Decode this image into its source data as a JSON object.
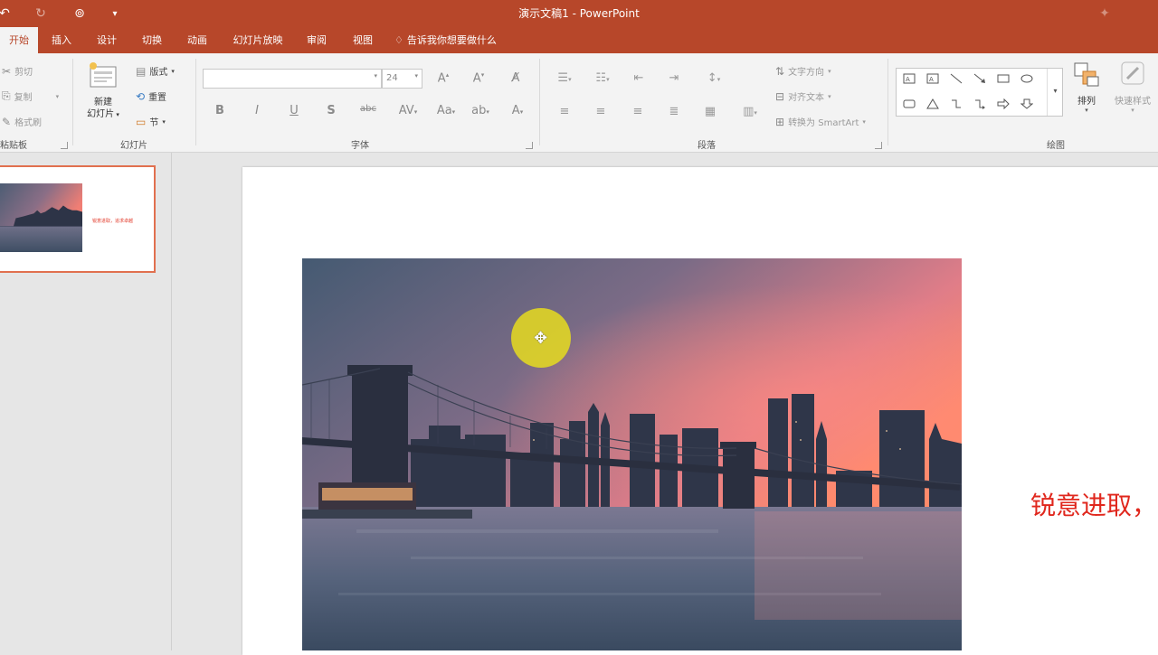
{
  "window": {
    "title": "演示文稿1  -  PowerPoint"
  },
  "qat": {
    "undo_icon": "undo-icon",
    "redo_icon": "redo-icon",
    "present_icon": "start-from-beginning-icon",
    "customize_icon": "customize-qat-icon"
  },
  "tabs": [
    {
      "label": "开始",
      "active": true
    },
    {
      "label": "插入"
    },
    {
      "label": "设计"
    },
    {
      "label": "切换"
    },
    {
      "label": "动画"
    },
    {
      "label": "幻灯片放映"
    },
    {
      "label": "审阅"
    },
    {
      "label": "视图"
    }
  ],
  "tell_me": {
    "text": "告诉我你想要做什么"
  },
  "clipboard": {
    "cut": "剪切",
    "copy": "复制",
    "format_painter": "格式刷",
    "group_label": "粘贴板"
  },
  "slides_group": {
    "new_slide_line1": "新建",
    "new_slide_line2": "幻灯片",
    "layout": "版式",
    "reset": "重置",
    "section": "节",
    "group_label": "幻灯片"
  },
  "font_group": {
    "font_name": "",
    "font_size": "24",
    "group_label": "字体"
  },
  "paragraph_group": {
    "text_direction": "文字方向",
    "align_text": "对齐文本",
    "convert_smartart": "转换为 SmartArt",
    "group_label": "段落"
  },
  "drawing_group": {
    "arrange": "排列",
    "quick_styles": "快速样式",
    "group_label": "绘图"
  },
  "slide": {
    "text": "锐意进取，",
    "thumb_text": "锐意进取，追求卓越"
  },
  "colors": {
    "accent": "#b7472a",
    "slide_text": "#e0271d",
    "thumb_border": "#e1704f"
  }
}
